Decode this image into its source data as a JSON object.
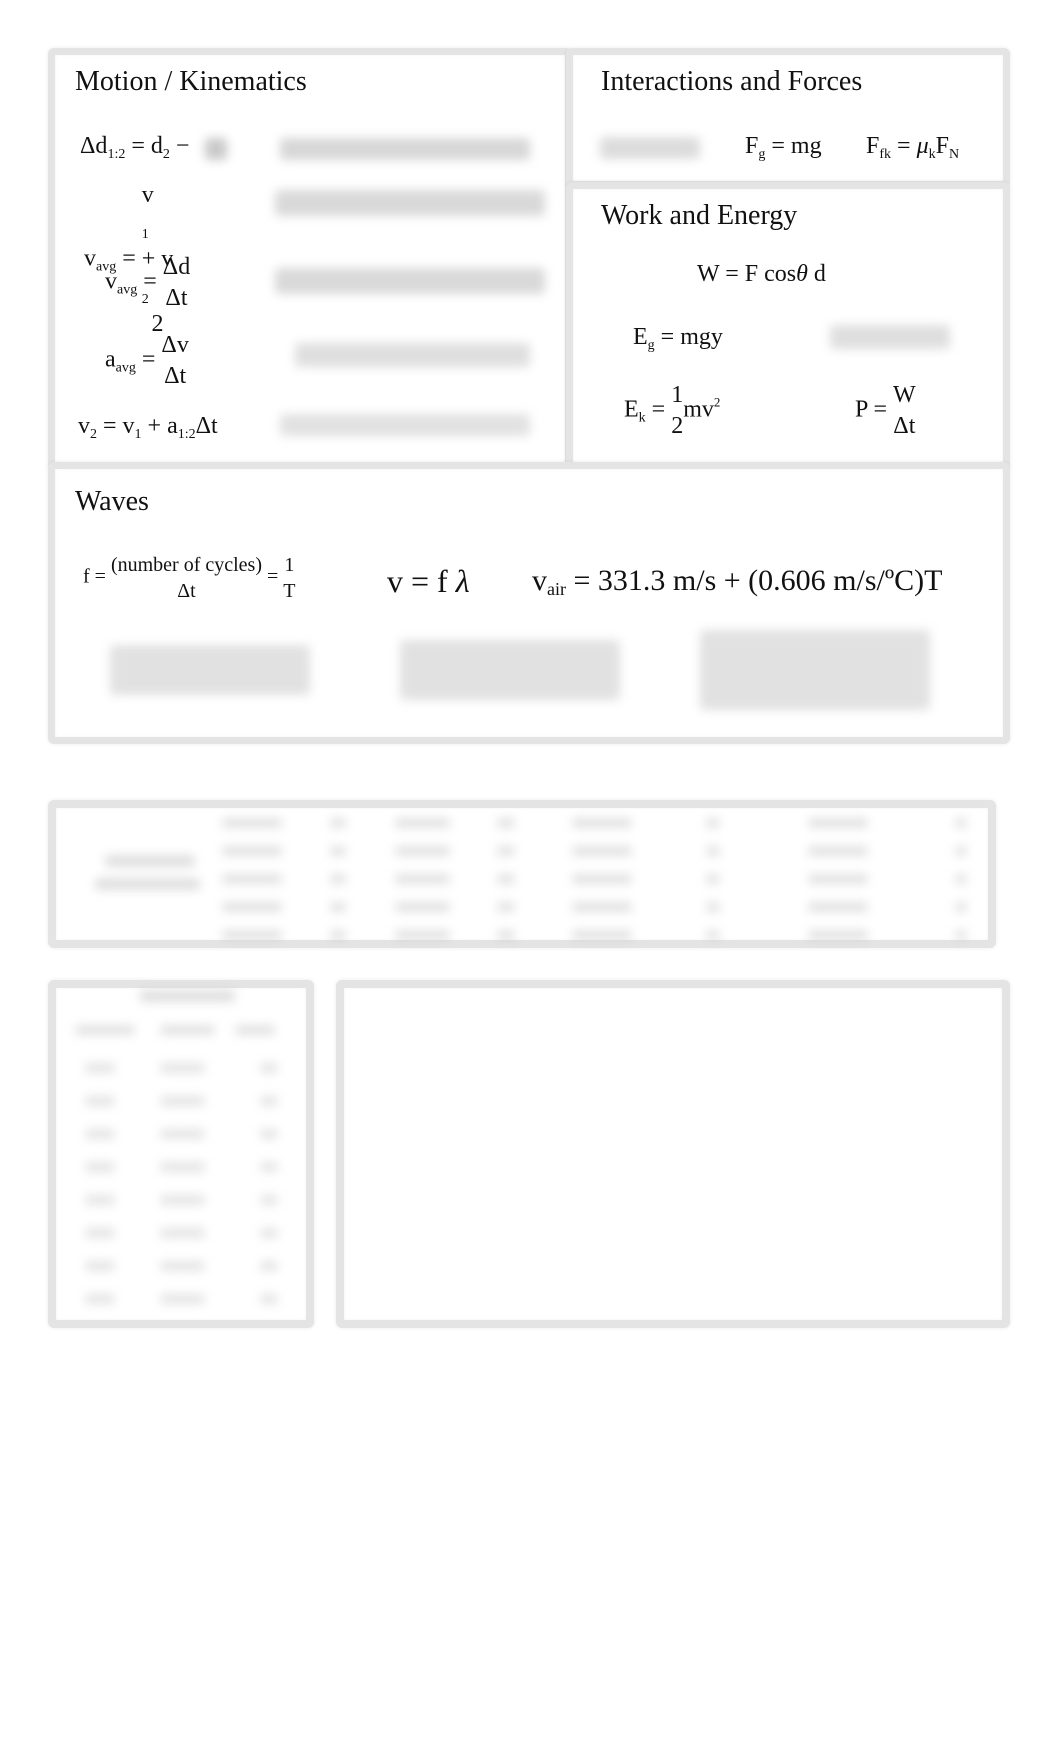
{
  "motion": {
    "title": "Motion / Kinematics",
    "eq1": {
      "lhs": "Δd",
      "lhs_sub": "1:2",
      "eq": " = d",
      "rhs_sub": "2",
      "tail": " −"
    },
    "eq2": {
      "lhs": "v",
      "lhs_sub": "avg",
      "eq": " = ",
      "num_a": "v",
      "num_a_sub": "1",
      "num_plus": " + v",
      "num_b_sub": "2",
      "den": "2"
    },
    "eq3": {
      "lhs": "v",
      "lhs_sub": "avg",
      "eq": " = ",
      "num": "Δd",
      "den": "Δt"
    },
    "eq4": {
      "lhs": "a",
      "lhs_sub": "avg",
      "eq": " = ",
      "num": "Δv",
      "den": "Δt"
    },
    "eq5": {
      "lhs": "v",
      "lhs_sub": "2",
      "eq": " = v",
      "mid_sub": "1",
      "plus": " + a",
      "a_sub": "1:2",
      "tail": "Δt"
    }
  },
  "forces": {
    "title": "Interactions and Forces",
    "fg": {
      "lhs": "F",
      "lhs_sub": "g",
      "rhs": " = mg"
    },
    "ffk": {
      "lhs": "F",
      "lhs_sub": "fk",
      "eq": " = ",
      "mu": "μ",
      "mu_sub": "k",
      "f": "F",
      "f_sub": "N"
    }
  },
  "energy": {
    "title": "Work and Energy",
    "work": {
      "lhs": "W = ",
      "rhs": "F cos",
      "theta": "θ",
      "tail": " d"
    },
    "eg": {
      "lhs": "E",
      "lhs_sub": "g",
      "rhs": " = mgy"
    },
    "ek": {
      "lhs": "E",
      "lhs_sub": "k",
      "eq": " = ",
      "num": "1",
      "den": "2",
      "tail": "mv",
      "tail_sup": "2"
    },
    "power": {
      "lhs": "P = ",
      "num": "W",
      "den": "Δt"
    }
  },
  "waves": {
    "title": "Waves",
    "freq": {
      "lhs": "f = ",
      "num": "(number of cycles)",
      "den": "Δt",
      "eq": " = ",
      "num2": "1",
      "den2": "T"
    },
    "wave_speed": {
      "lhs": "v = ",
      "f": "f",
      "lambda": "λ"
    },
    "air_speed": {
      "lhs": "v",
      "lhs_sub": "air",
      "rhs": " = 331.3 m/s + (0.606 m/s/ºC)T"
    }
  }
}
